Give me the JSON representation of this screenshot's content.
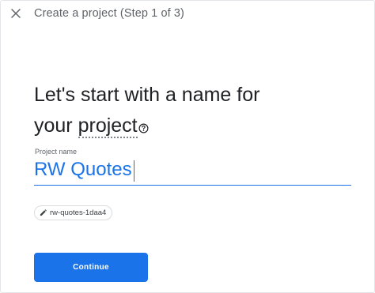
{
  "header": {
    "close_icon": "close-icon",
    "title": "Create a project (Step 1 of 3)"
  },
  "heading": {
    "line1": "Let's start with a name for",
    "prefix": "your ",
    "project_word": "project",
    "help_icon": "help-circle-icon"
  },
  "project_name_field": {
    "label": "Project name",
    "value": "RW Quotes"
  },
  "project_id_chip": {
    "edit_icon": "pencil-icon",
    "value": "rw-quotes-1daa4"
  },
  "continue_button": {
    "label": "Continue"
  },
  "colors": {
    "accent": "#1a73e8",
    "text_primary": "#202124",
    "text_secondary": "#5f6368"
  }
}
